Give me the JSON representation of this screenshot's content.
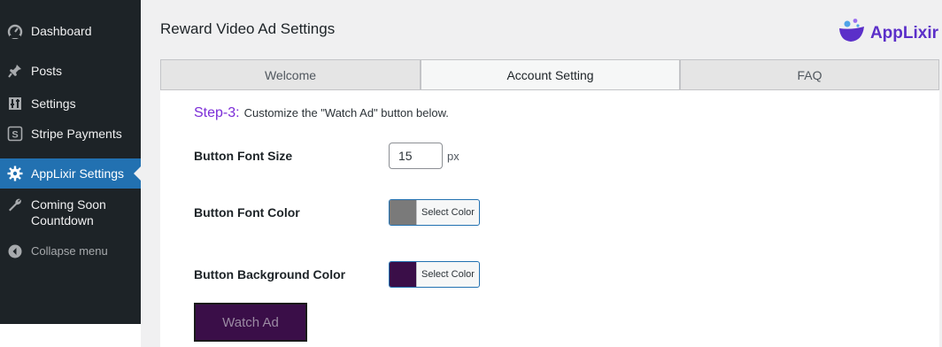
{
  "sidebar": {
    "items": [
      {
        "label": "Dashboard",
        "icon": "dashboard-icon"
      },
      {
        "label": "Posts",
        "icon": "pin-icon"
      },
      {
        "label": "Settings",
        "icon": "settings-sliders-icon"
      },
      {
        "label": "Stripe Payments",
        "icon": "stripe-icon"
      },
      {
        "label": "AppLixir Settings",
        "icon": "gear-icon",
        "active": true
      },
      {
        "label": "Coming Soon Countdown",
        "icon": "wrench-icon"
      }
    ],
    "collapse_label": "Collapse menu"
  },
  "page": {
    "title": "Reward Video Ad Settings",
    "brand": "AppLixir"
  },
  "tabs": [
    {
      "label": "Welcome"
    },
    {
      "label": "Account Setting",
      "active": true
    },
    {
      "label": "FAQ"
    }
  ],
  "step": {
    "label": "Step-3:",
    "text": "Customize the \"Watch Ad\" button below."
  },
  "form": {
    "font_size_label": "Button Font Size",
    "font_size_value": "15",
    "font_size_unit": "px",
    "font_color_label": "Button Font Color",
    "font_color_value": "#7a7a7a",
    "bg_color_label": "Button Background Color",
    "bg_color_value": "#3a0e48",
    "select_color_label": "Select Color"
  },
  "preview": {
    "button_label": "Watch Ad"
  },
  "colors": {
    "sidebar_bg": "#1d2327",
    "active_menu": "#2271b1",
    "step_accent": "#7b2cd7",
    "brand": "#5b2fc9"
  }
}
